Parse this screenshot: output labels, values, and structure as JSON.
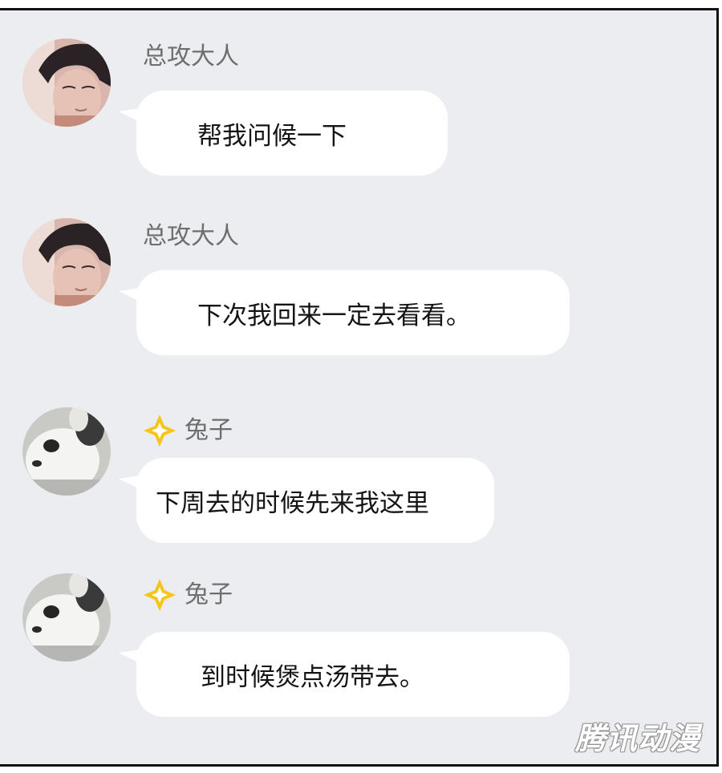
{
  "messages": [
    {
      "sender": "总攻大人",
      "avatar": "man-portrait-avatar",
      "vip_badge": false,
      "text": "帮我问候一下"
    },
    {
      "sender": "总攻大人",
      "avatar": "man-portrait-avatar",
      "vip_badge": false,
      "text": "下次我回来一定去看看。"
    },
    {
      "sender": "兔子",
      "avatar": "bunny-avatar",
      "vip_badge": true,
      "text": "下周去的时候先来我这里"
    },
    {
      "sender": "兔子",
      "avatar": "bunny-avatar",
      "vip_badge": true,
      "text": "到时候煲点汤带去。"
    }
  ],
  "watermark": "腾讯动漫",
  "colors": {
    "panel_background": "#ebedf1",
    "bubble": "#ffffff",
    "sender_name": "#6e6e6e",
    "vip_badge": "#f5c518",
    "text": "#141414"
  }
}
